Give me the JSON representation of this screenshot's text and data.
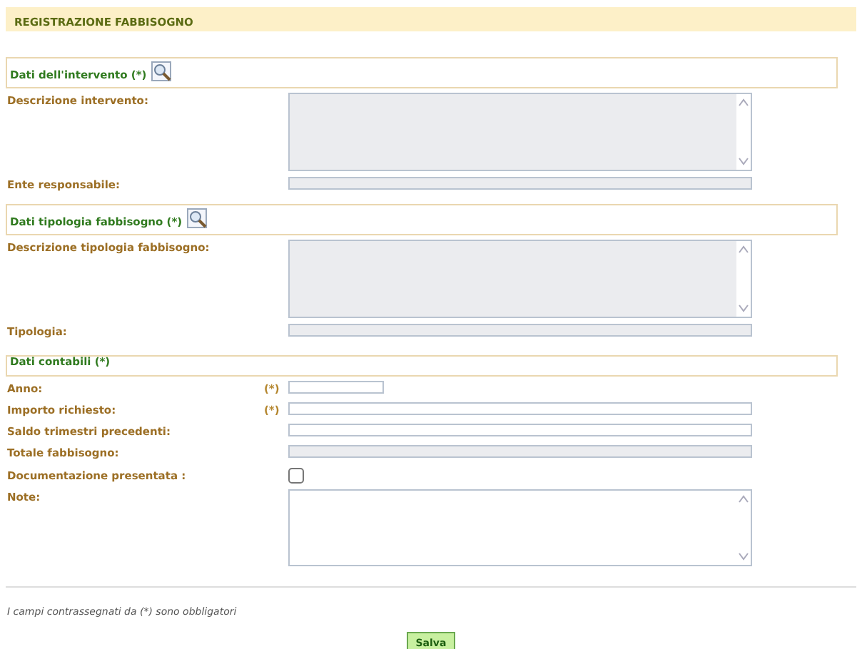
{
  "header": {
    "title": "REGISTRAZIONE FABBISOGNO"
  },
  "sections": [
    {
      "title": "Dati dell'intervento (*)",
      "lookup": true,
      "fields": [
        {
          "label": "Descrizione intervento:",
          "kind": "textarea",
          "disabled": true
        },
        {
          "label": "Ente responsabile:",
          "kind": "input",
          "disabled": true
        }
      ]
    },
    {
      "title": "Dati tipologia fabbisogno (*)",
      "lookup": true,
      "fields": [
        {
          "label": "Descrizione tipologia fabbisogno:",
          "kind": "textarea",
          "disabled": true
        },
        {
          "label": "Tipologia:",
          "kind": "input",
          "disabled": true
        }
      ]
    },
    {
      "title": "Dati contabili (*)",
      "lookup": false,
      "fields": [
        {
          "label": "Anno:",
          "required": "(*)",
          "kind": "short-input",
          "disabled": false
        },
        {
          "label": "Importo richiesto:",
          "required": "(*)",
          "kind": "input",
          "disabled": false
        },
        {
          "label": "Saldo trimestri precedenti:",
          "kind": "input",
          "disabled": false
        },
        {
          "label": "Totale fabbisogno:",
          "kind": "input",
          "disabled": true
        },
        {
          "label": "Documentazione presentata :",
          "kind": "checkbox",
          "checked": false
        },
        {
          "label": "Note:",
          "kind": "textarea",
          "disabled": false
        }
      ]
    }
  ],
  "footnote": "I campi contrassegnati da (*) sono obbligatori",
  "buttons": [
    "Salva"
  ]
}
